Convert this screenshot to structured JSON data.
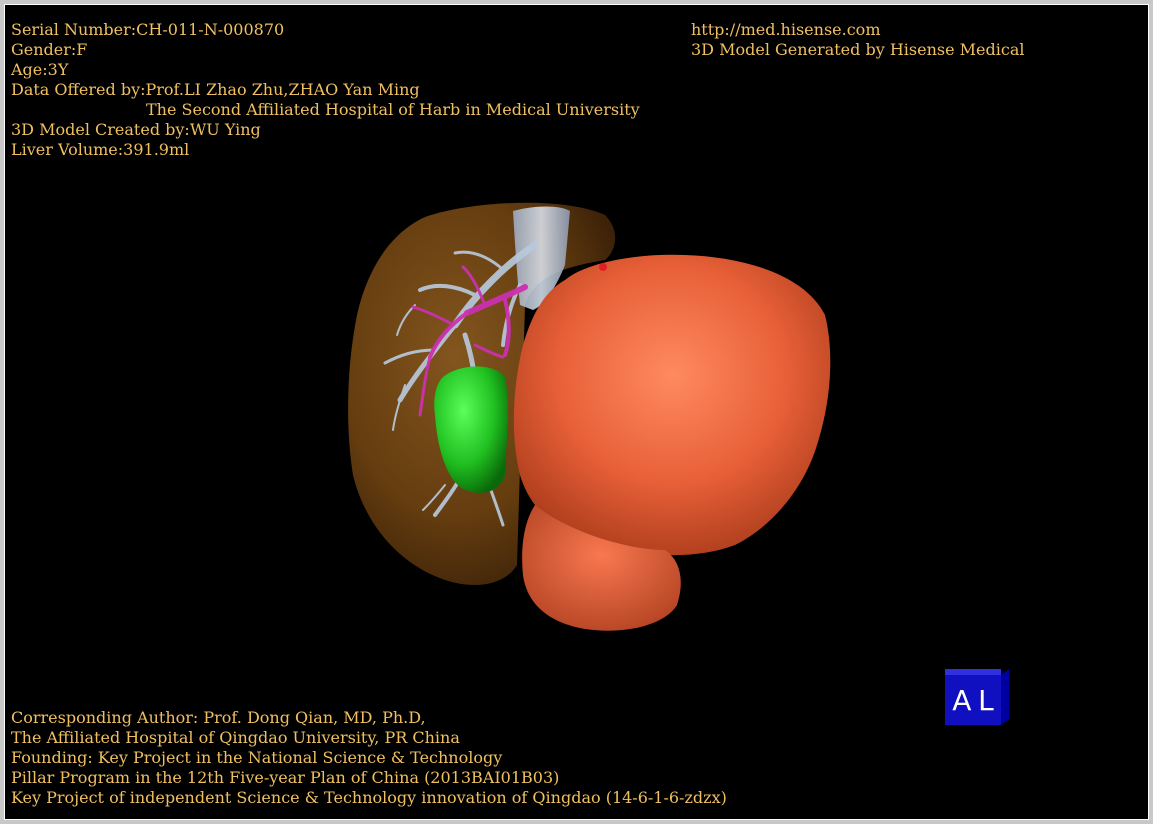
{
  "colors": {
    "text": "#f0c060",
    "background": "#000000",
    "liver": "#6a4010",
    "tumor": "#e86038",
    "gallbladder": "#20c020",
    "hepatic_vein": "#cc30b0",
    "portal_vein": "#b8c8dc",
    "cube_face": "#1010c0",
    "cube_side": "#0000a0",
    "cube_top": "#3030e0"
  },
  "patient_info": {
    "serial_number": "Serial Number:CH-011-N-000870",
    "gender": "Gender:F",
    "age": "Age:3Y",
    "data_offered": "Data Offered by:Prof.LI Zhao Zhu,ZHAO Yan Ming",
    "hospital": "The Second Affiliated Hospital of Harb in Medical University",
    "created_by": "3D Model Created by:WU Ying",
    "liver_volume": "Liver Volume:391.9ml"
  },
  "brand": {
    "url": "http://med.hisense.com",
    "generated_by": "3D Model Generated by Hisense Medical"
  },
  "credits": {
    "line1": "Corresponding Author: Prof. Dong Qian, MD, Ph.D,",
    "line2": "The Affiliated Hospital of Qingdao University, PR China",
    "line3": "Founding: Key Project in the National Science & Technology",
    "line4": "Pillar Program in the 12th Five-year Plan of China (2013BAI01B03)",
    "line5": "Key Project of independent Science & Technology innovation of Qingdao (14-6-1-6-zdzx)"
  },
  "orientation_cube": {
    "left_label": "A",
    "right_label": "L"
  }
}
